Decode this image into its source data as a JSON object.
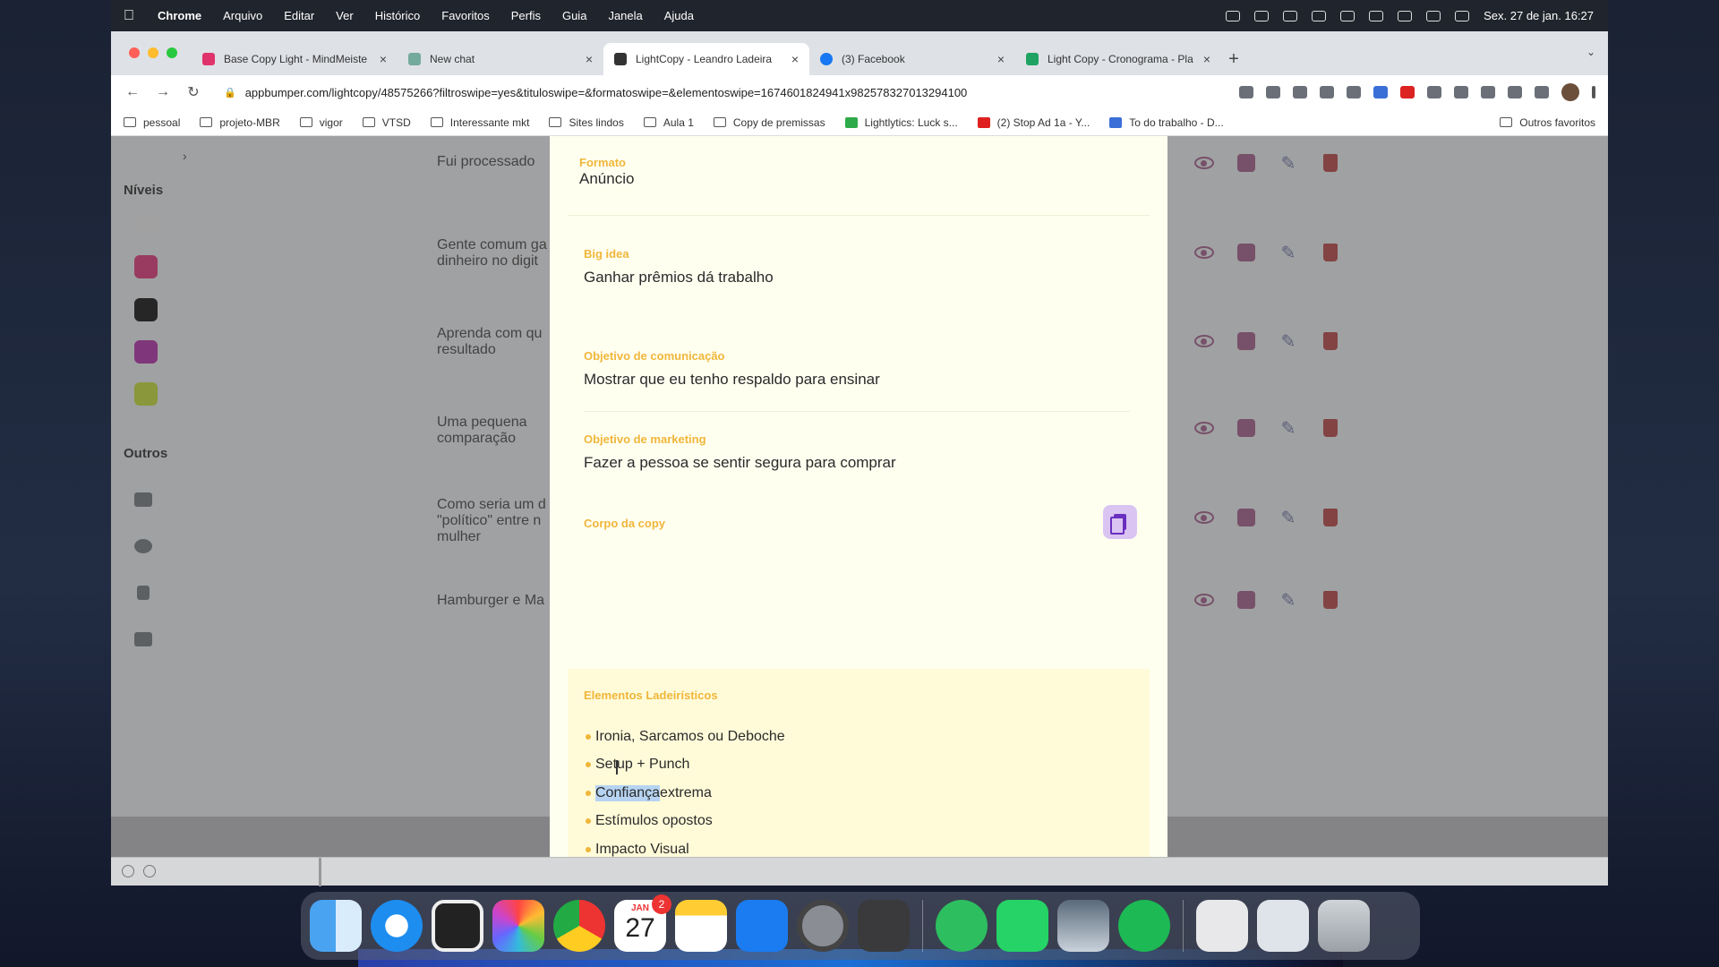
{
  "menubar": {
    "app": "Chrome",
    "items": [
      "Arquivo",
      "Editar",
      "Ver",
      "Histórico",
      "Favoritos",
      "Perfis",
      "Guia",
      "Janela",
      "Ajuda"
    ],
    "clock": "Sex. 27 de jan.  16:27"
  },
  "tabs": [
    {
      "title": "Base Copy Light - MindMeiste",
      "icon": "mindmeister-icon",
      "color": "#e0336b"
    },
    {
      "title": "New chat",
      "icon": "chatgpt-icon",
      "color": "#74aa9c"
    },
    {
      "title": "LightCopy - Leandro Ladeira",
      "icon": "layers-icon",
      "color": "#333333",
      "active": true
    },
    {
      "title": "(3) Facebook",
      "icon": "facebook-icon",
      "color": "#1877f2"
    },
    {
      "title": "Light Copy - Cronograma - Pla",
      "icon": "sheets-icon",
      "color": "#1ea362"
    }
  ],
  "toolbar": {
    "url": "appbumper.com/lightcopy/48575266?filtroswipe=yes&tituloswipe=&formatoswipe=&elementoswipe=1674601824941x982578327013294100"
  },
  "bookmarks": {
    "items": [
      {
        "label": "pessoal",
        "type": "folder"
      },
      {
        "label": "projeto-MBR",
        "type": "folder"
      },
      {
        "label": "vigor",
        "type": "folder"
      },
      {
        "label": "VTSD",
        "type": "folder"
      },
      {
        "label": "Interessante mkt",
        "type": "folder"
      },
      {
        "label": "Sites lindos",
        "type": "folder"
      },
      {
        "label": "Aula 1",
        "type": "folder"
      },
      {
        "label": "Copy de premissas",
        "type": "folder"
      },
      {
        "label": "Lightlytics: Luck s...",
        "type": "link",
        "color": "#2faa4a"
      },
      {
        "label": "(2) Stop Ad 1a - Y...",
        "type": "link",
        "color": "#e02020"
      },
      {
        "label": "To do trabalho - D...",
        "type": "link",
        "color": "#3a6fd8"
      }
    ],
    "other": "Outros favoritos"
  },
  "sidebar": {
    "levels_title": "Níveis",
    "level_colors": [
      "#f4f4f4",
      "#e85a93",
      "#3a3a3a",
      "#c353b9",
      "#d2e65a"
    ],
    "others_title": "Outros"
  },
  "list": {
    "items": [
      {
        "text1": "Fui processado",
        "text2": ""
      },
      {
        "text1": "Gente comum ga",
        "text2": "dinheiro no digit"
      },
      {
        "text1": "Aprenda com qu",
        "text2": "resultado"
      },
      {
        "text1": "Uma pequena",
        "text2": "comparação"
      },
      {
        "text1": "Como seria um d",
        "text2": "\"político\" entre n",
        "text3": "mulher"
      },
      {
        "text1": "Hamburger e Ma",
        "text2": ""
      }
    ]
  },
  "modal": {
    "formato_label": "Formato",
    "formato_value": "Anúncio",
    "bigidea_label": "Big idea",
    "bigidea_value": "Ganhar prêmios dá trabalho",
    "comunicacao_label": "Objetivo de comunicação",
    "comunicacao_value": "Mostrar que eu tenho respaldo para ensinar",
    "marketing_label": "Objetivo de marketing",
    "marketing_value": "Fazer a pessoa se sentir segura para comprar",
    "corpo_label": "Corpo da copy",
    "elementos_label": "Elementos Ladeirísticos",
    "elementos": [
      "Ironia, Sarcamos ou Deboche",
      "Setup + Punch",
      "Confiança extrema",
      "Estímulos opostos",
      "Impacto Visual"
    ],
    "highlighted_word": "Confiança",
    "highlighted_rest": " extrema"
  },
  "dock": {
    "calendar_month": "JAN",
    "calendar_day": "27",
    "calendar_badge": "2"
  }
}
